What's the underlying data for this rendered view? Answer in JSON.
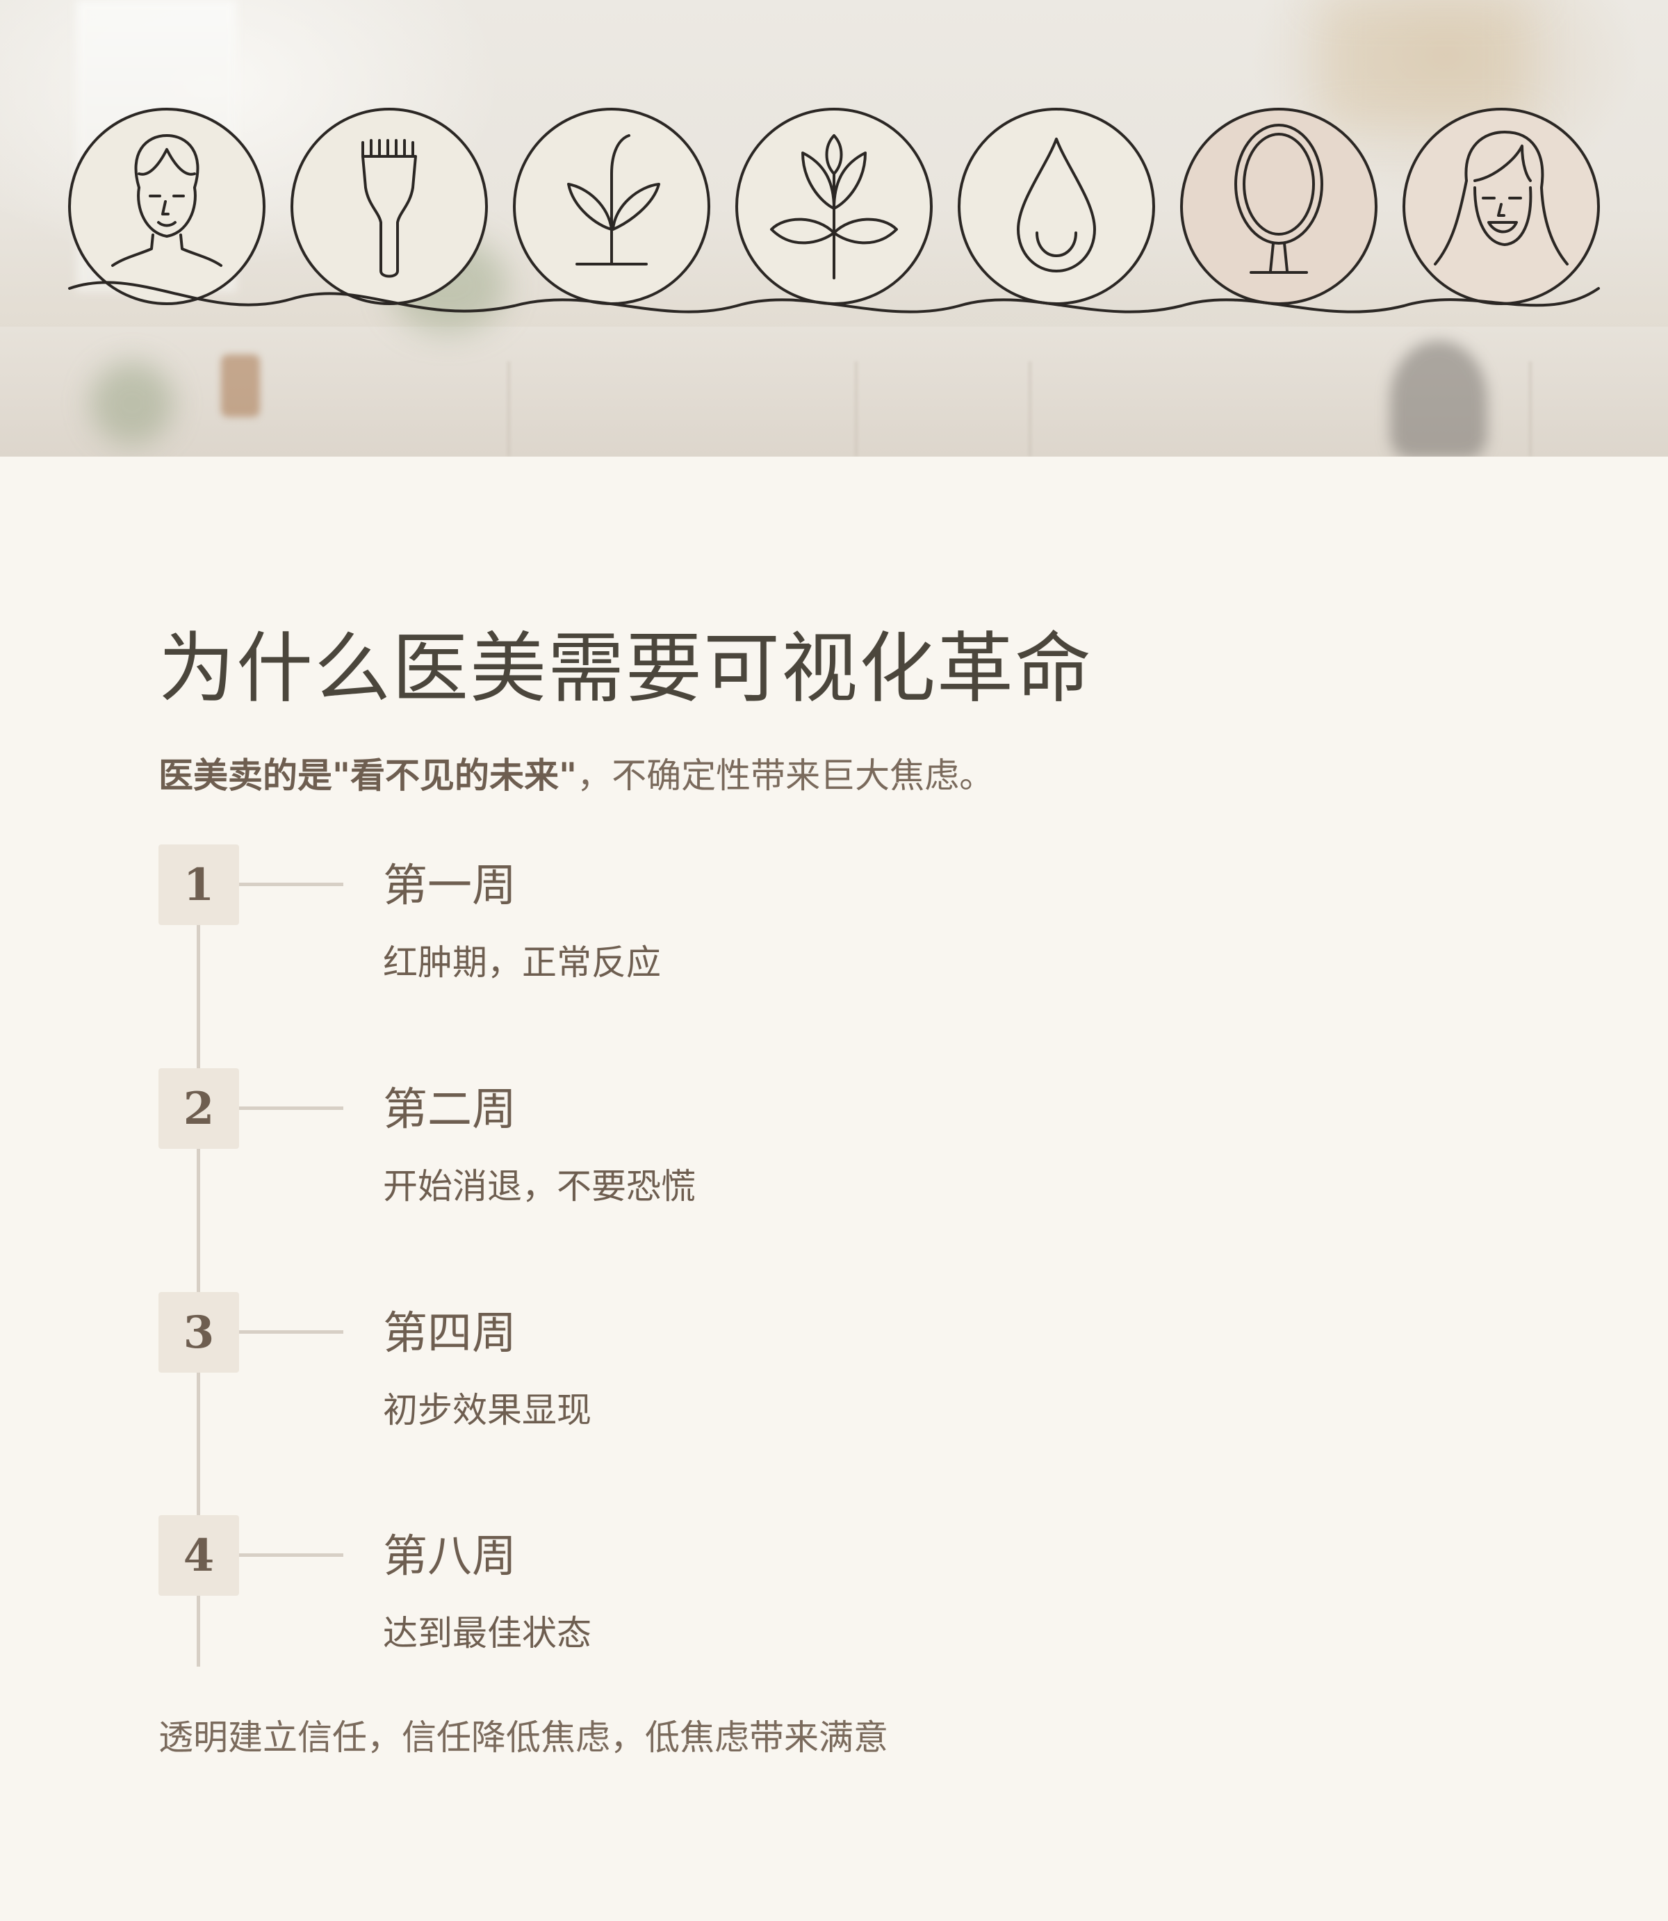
{
  "hero": {
    "icons": [
      {
        "name": "woman-face-icon",
        "fill": "#efebe1"
      },
      {
        "name": "brush-icon",
        "fill": "#efebe1"
      },
      {
        "name": "sprout-icon",
        "fill": "#efebe1"
      },
      {
        "name": "plant-icon",
        "fill": "#efebe1"
      },
      {
        "name": "droplet-icon",
        "fill": "#efebe1"
      },
      {
        "name": "mirror-icon",
        "fill": "#e6d8cc"
      },
      {
        "name": "smiling-woman-icon",
        "fill": "#e9ddd2"
      }
    ],
    "line_color": "#2b2724"
  },
  "title": "为什么医美需要可视化革命",
  "subtitle": {
    "bold": "医美卖的是\"看不见的未来\"",
    "rest": "，不确定性带来巨大焦虑。"
  },
  "steps": [
    {
      "number": "1",
      "week": "第一周",
      "desc": "红肿期，正常反应"
    },
    {
      "number": "2",
      "week": "第二周",
      "desc": "开始消退，不要恐慌"
    },
    {
      "number": "3",
      "week": "第四周",
      "desc": "初步效果显现"
    },
    {
      "number": "4",
      "week": "第八周",
      "desc": "达到最佳状态"
    }
  ],
  "footer": "透明建立信任，信任降低焦虑，低焦虑带来满意",
  "colors": {
    "background": "#f9f6f0",
    "title": "#4b463c",
    "text": "#6e5e50",
    "badge": "#ede6dc",
    "line": "#d7cfc5"
  }
}
